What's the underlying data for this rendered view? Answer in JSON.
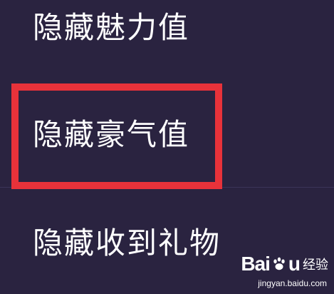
{
  "menu": {
    "items": [
      {
        "label": "隐藏魅力值"
      },
      {
        "label": "隐藏豪气值"
      },
      {
        "label": "隐藏收到礼物"
      }
    ]
  },
  "watermark": {
    "brand_left": "Bai",
    "brand_right": "u",
    "brand_cn": "经验",
    "domain": "jingyan.baidu.com"
  },
  "colors": {
    "background": "#2a2340",
    "highlight": "#e8323a",
    "text": "#ffffff"
  }
}
